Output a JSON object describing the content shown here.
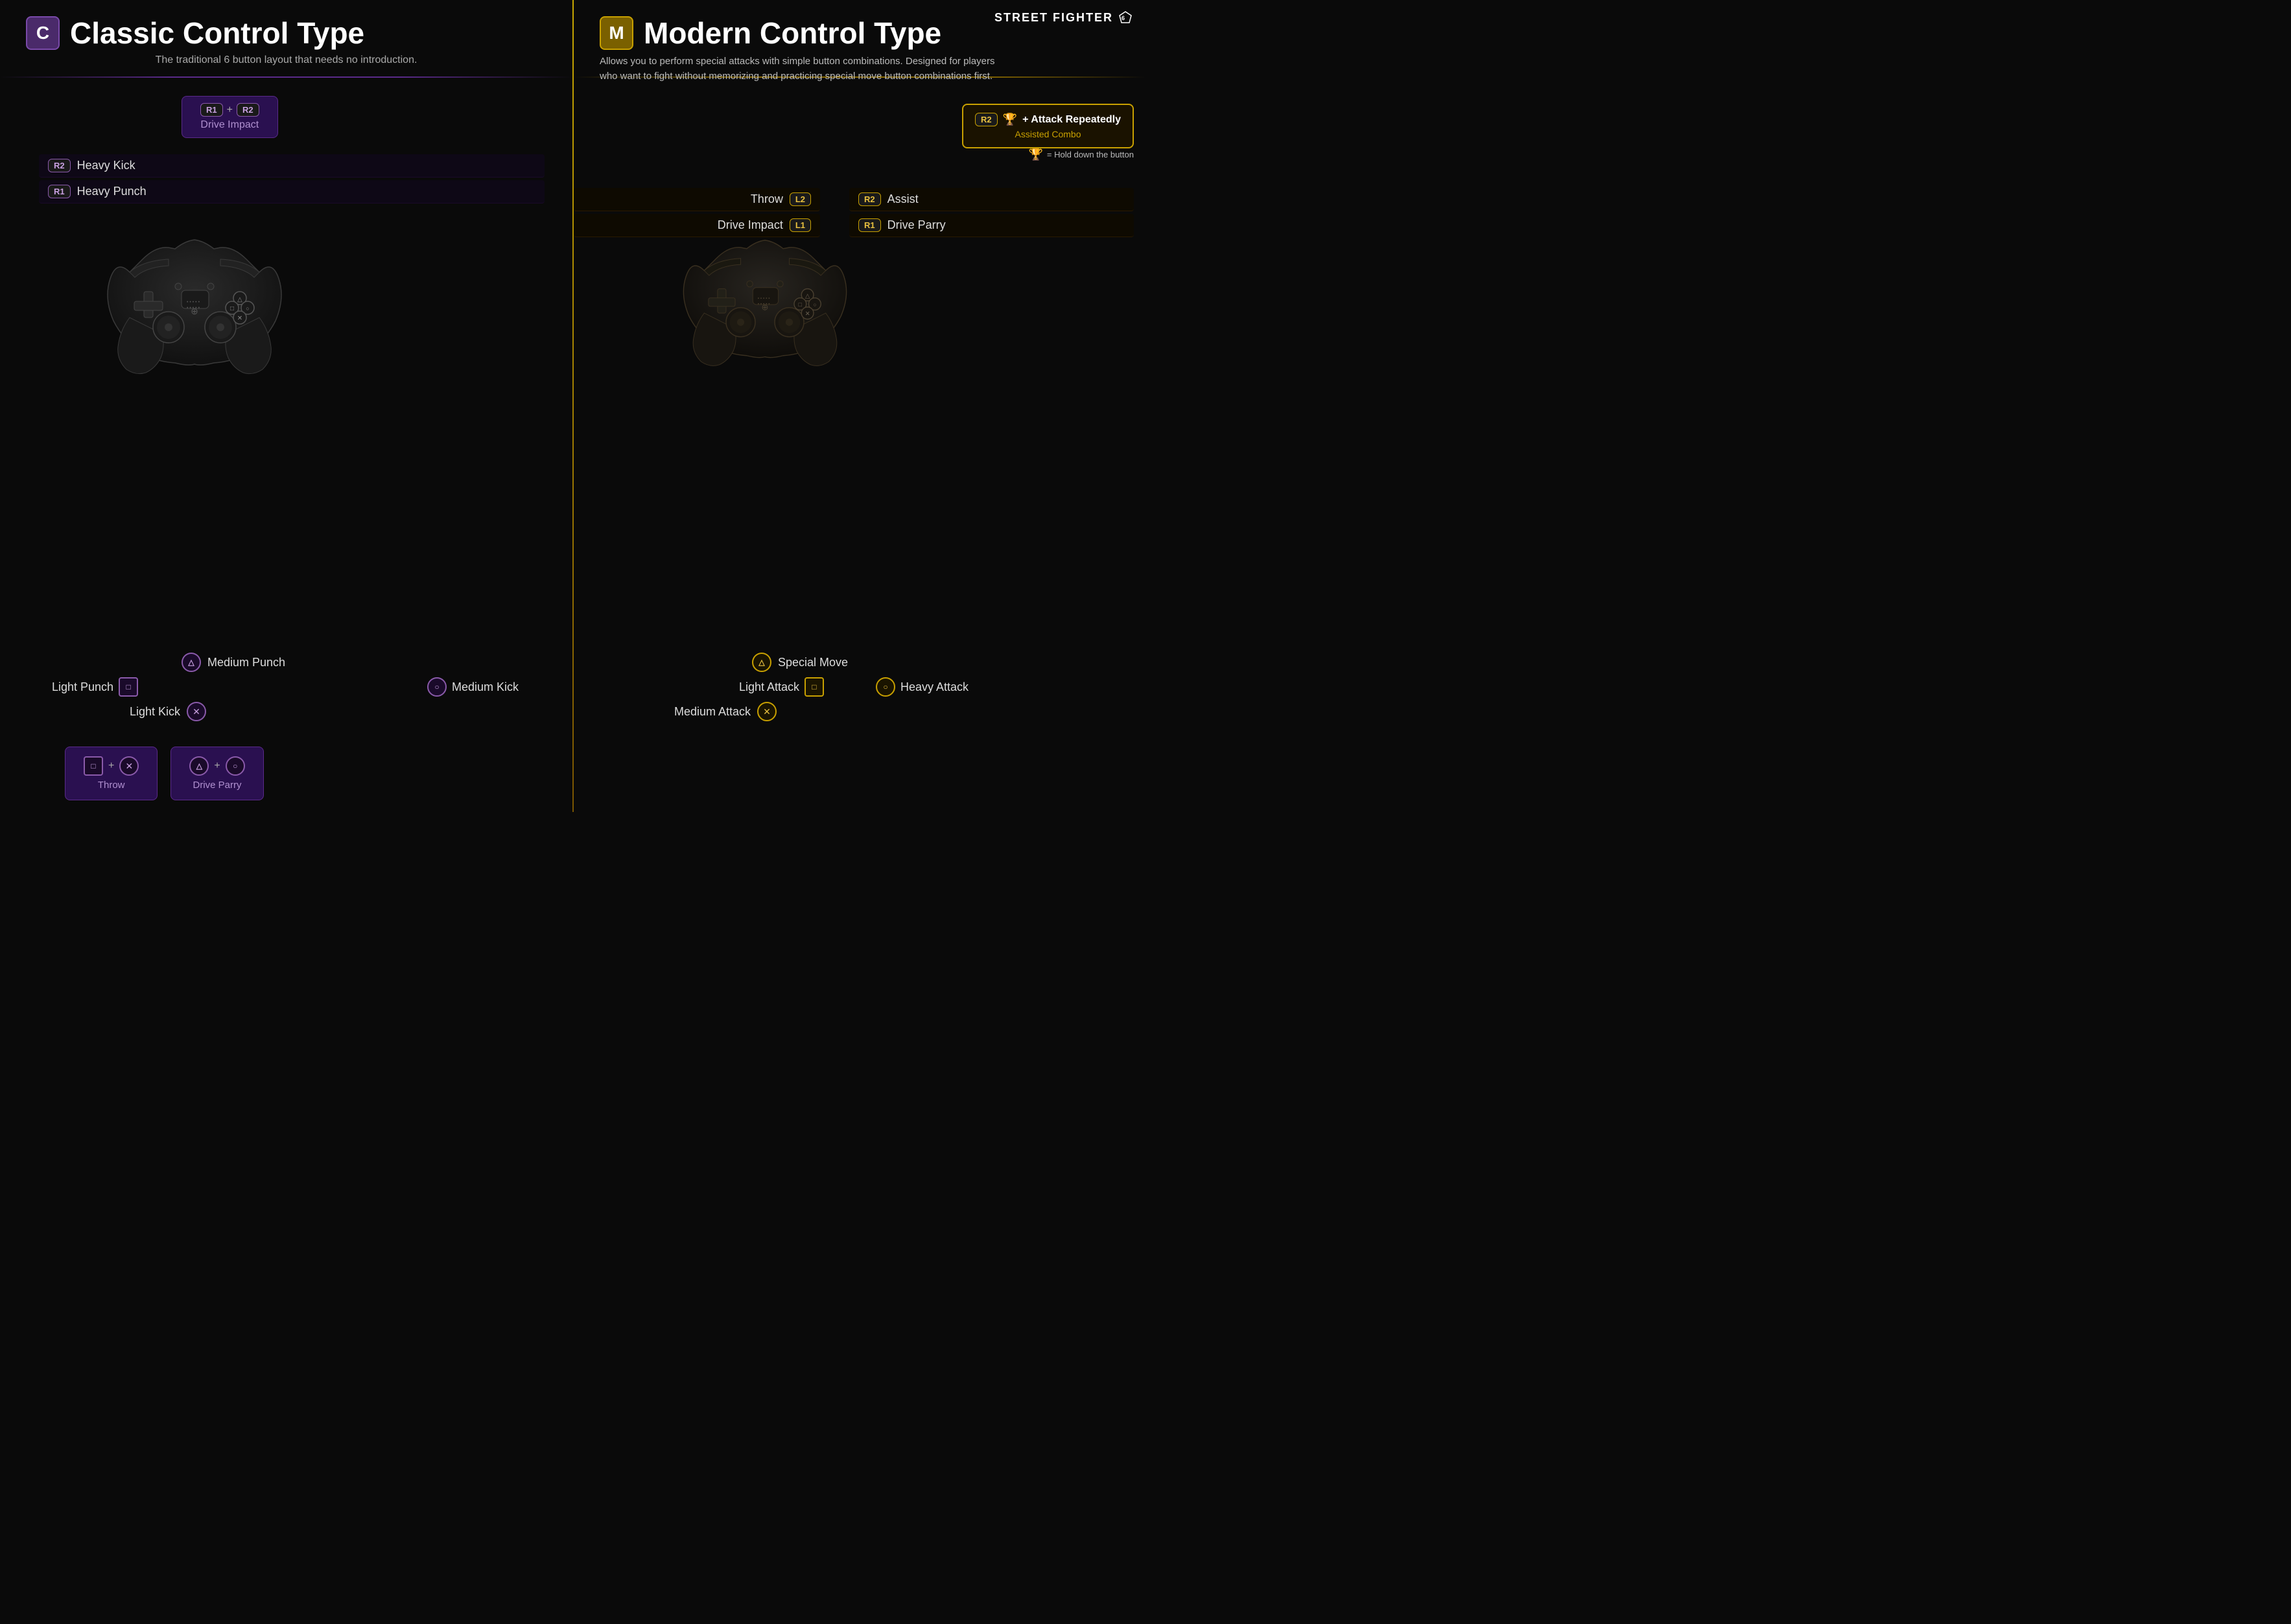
{
  "brand": {
    "name": "STREET FIGHTER 6",
    "logo_text": "STREET FIGHTER"
  },
  "classic": {
    "badge": "C",
    "title": "Classic Control Type",
    "subtitle": "The traditional 6 button layout that needs no introduction.",
    "drive_impact": {
      "btn1": "R1",
      "btn2": "R2",
      "plus": "+",
      "label": "Drive Impact"
    },
    "heavy_kick": {
      "btn": "R2",
      "label": "Heavy Kick"
    },
    "heavy_punch": {
      "btn": "R1",
      "label": "Heavy Punch"
    },
    "medium_punch": {
      "icon": "△",
      "label": "Medium Punch"
    },
    "light_punch": {
      "icon": "□",
      "label": "Light Punch"
    },
    "medium_kick": {
      "icon": "○",
      "label": "Medium Kick"
    },
    "light_kick": {
      "icon": "✕",
      "label": "Light Kick"
    },
    "throw": {
      "icon1": "□",
      "plus": "+",
      "icon2": "✕",
      "label": "Throw"
    },
    "drive_parry": {
      "icon1": "△",
      "plus": "+",
      "icon2": "○",
      "label": "Drive Parry"
    }
  },
  "modern": {
    "badge": "M",
    "title": "Modern Control Type",
    "subtitle1": "Allows you to perform special attacks with simple button combinations. Designed for players",
    "subtitle2": "who want to fight without memorizing and practicing special move button combinations first.",
    "hold_note": "= Hold down the button",
    "assisted_combo": {
      "btn": "R2",
      "icon": "🏆",
      "label": "+ Attack Repeatedly",
      "sub": "Assisted Combo"
    },
    "throw": {
      "label": "Throw",
      "btn": "L2"
    },
    "assist": {
      "btn": "R2",
      "label": "Assist"
    },
    "drive_impact": {
      "label": "Drive Impact",
      "btn": "L1"
    },
    "drive_parry": {
      "btn": "R1",
      "label": "Drive Parry"
    },
    "special_move": {
      "icon": "△",
      "label": "Special Move"
    },
    "light_attack": {
      "icon": "□",
      "label": "Light Attack"
    },
    "heavy_attack": {
      "icon": "○",
      "label": "Heavy Attack"
    },
    "medium_attack": {
      "icon": "✕",
      "label": "Medium Attack"
    }
  }
}
